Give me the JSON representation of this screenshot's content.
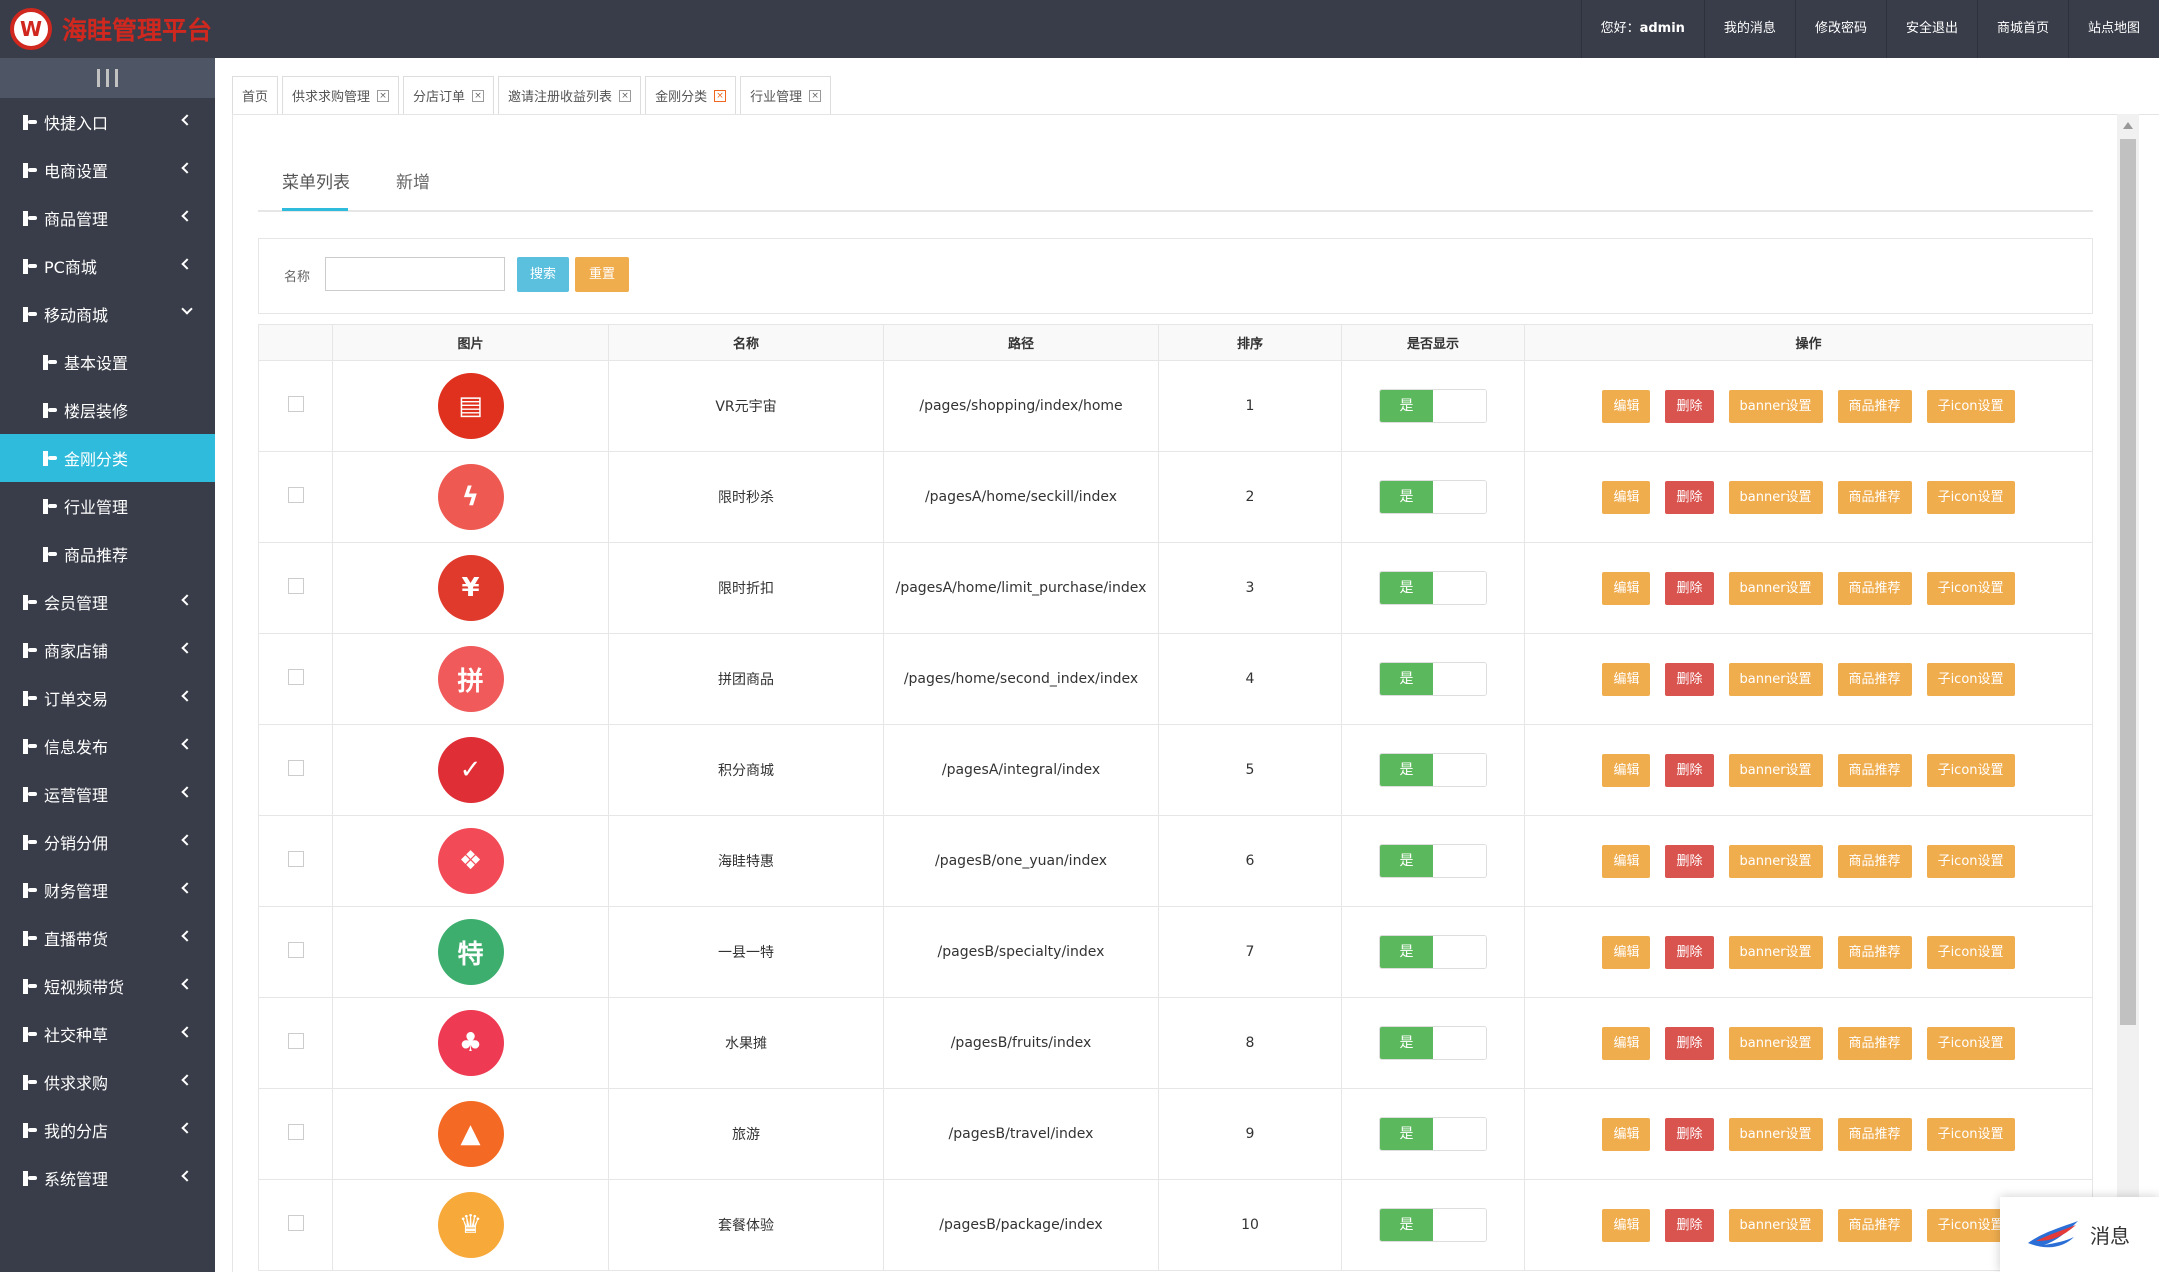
{
  "header": {
    "logo_letter": "W",
    "app_title": "海眭管理平台",
    "greeting_prefix": "您好：",
    "username": "admin",
    "nav": [
      "我的消息",
      "修改密码",
      "安全退出",
      "商城首页",
      "站点地图"
    ]
  },
  "sidebar": {
    "items": [
      {
        "label": "快捷入口",
        "sub": false,
        "arrow": "left"
      },
      {
        "label": "电商设置",
        "sub": false,
        "arrow": "left"
      },
      {
        "label": "商品管理",
        "sub": false,
        "arrow": "left"
      },
      {
        "label": "PC商城",
        "sub": false,
        "arrow": "left"
      },
      {
        "label": "移动商城",
        "sub": false,
        "arrow": "down"
      },
      {
        "label": "基本设置",
        "sub": true
      },
      {
        "label": "楼层装修",
        "sub": true
      },
      {
        "label": "金刚分类",
        "sub": true,
        "active": true
      },
      {
        "label": "行业管理",
        "sub": true
      },
      {
        "label": "商品推荐",
        "sub": true
      },
      {
        "label": "会员管理",
        "sub": false,
        "arrow": "left"
      },
      {
        "label": "商家店铺",
        "sub": false,
        "arrow": "left"
      },
      {
        "label": "订单交易",
        "sub": false,
        "arrow": "left"
      },
      {
        "label": "信息发布",
        "sub": false,
        "arrow": "left"
      },
      {
        "label": "运营管理",
        "sub": false,
        "arrow": "left"
      },
      {
        "label": "分销分佣",
        "sub": false,
        "arrow": "left"
      },
      {
        "label": "财务管理",
        "sub": false,
        "arrow": "left"
      },
      {
        "label": "直播带货",
        "sub": false,
        "arrow": "left"
      },
      {
        "label": "短视频带货",
        "sub": false,
        "arrow": "left"
      },
      {
        "label": "社交种草",
        "sub": false,
        "arrow": "left"
      },
      {
        "label": "供求求购",
        "sub": false,
        "arrow": "left"
      },
      {
        "label": "我的分店",
        "sub": false,
        "arrow": "left"
      },
      {
        "label": "系统管理",
        "sub": false,
        "arrow": "left"
      }
    ]
  },
  "tabs": [
    {
      "label": "首页",
      "closable": false
    },
    {
      "label": "供求求购管理",
      "closable": true
    },
    {
      "label": "分店订单",
      "closable": true
    },
    {
      "label": "邀请注册收益列表",
      "closable": true
    },
    {
      "label": "金刚分类",
      "closable": true,
      "active": true
    },
    {
      "label": "行业管理",
      "closable": true
    }
  ],
  "subtabs": {
    "list": "菜单列表",
    "add": "新增"
  },
  "search": {
    "label": "名称",
    "value": "",
    "search_btn": "搜索",
    "reset_btn": "重置"
  },
  "table": {
    "headers": [
      "",
      "图片",
      "名称",
      "路径",
      "排序",
      "是否显示",
      "操作"
    ],
    "show_label": "是",
    "actions": [
      "编辑",
      "删除",
      "banner设置",
      "商品推荐",
      "子icon设置"
    ],
    "rows": [
      {
        "name": "VR元宇宙",
        "path": "/pages/shopping/index/home",
        "sort": "1",
        "icon": "shop-icon",
        "glyph": "▤",
        "color": "#e0301e"
      },
      {
        "name": "限时秒杀",
        "path": "/pagesA/home/seckill/index",
        "sort": "2",
        "icon": "stopwatch-icon",
        "glyph": "ϟ",
        "color": "#ee5a52"
      },
      {
        "name": "限时折扣",
        "path": "/pagesA/home/limit_purchase/index",
        "sort": "3",
        "icon": "yen-ticket-icon",
        "glyph": "¥",
        "color": "#e03a2c"
      },
      {
        "name": "拼团商品",
        "path": "/pages/home/second_index/index",
        "sort": "4",
        "icon": "group-bag-icon",
        "glyph": "拼",
        "color": "#f05a5a"
      },
      {
        "name": "积分商城",
        "path": "/pagesA/integral/index",
        "sort": "5",
        "icon": "points-bag-icon",
        "glyph": "✓",
        "color": "#e02e36"
      },
      {
        "name": "海眭特惠",
        "path": "/pagesB/one_yuan/index",
        "sort": "6",
        "icon": "gift-icon",
        "glyph": "❖",
        "color": "#f24a56"
      },
      {
        "name": "一县一特",
        "path": "/pagesB/specialty/index",
        "sort": "7",
        "icon": "specialty-icon",
        "glyph": "特",
        "color": "#3dae6e"
      },
      {
        "name": "水果摊",
        "path": "/pagesB/fruits/index",
        "sort": "8",
        "icon": "cherry-icon",
        "glyph": "♣",
        "color": "#ee3a52"
      },
      {
        "name": "旅游",
        "path": "/pagesB/travel/index",
        "sort": "9",
        "icon": "mountain-icon",
        "glyph": "▲",
        "color": "#f46a24"
      },
      {
        "name": "套餐体验",
        "path": "/pagesB/package/index",
        "sort": "10",
        "icon": "vr-crown-icon",
        "glyph": "♛",
        "color": "#f7a93a"
      }
    ]
  },
  "message_widget": {
    "label": "消息"
  }
}
